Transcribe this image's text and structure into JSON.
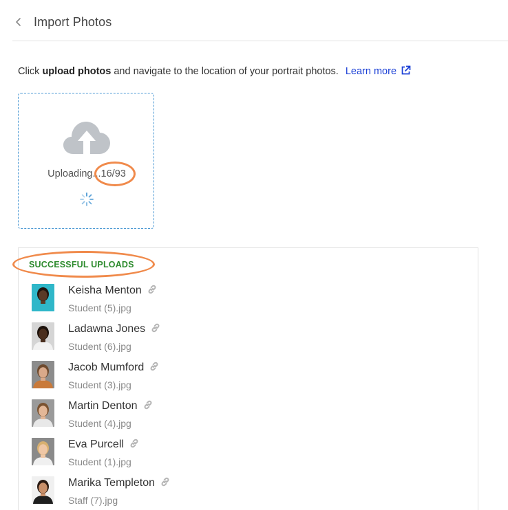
{
  "header": {
    "title": "Import Photos",
    "back_icon": "chevron-left-icon"
  },
  "instruction": {
    "prefix": "Click ",
    "bold": "upload photos",
    "suffix": " and navigate to the location of your portrait photos.",
    "learn_more": "Learn more",
    "learn_more_color": "#1a3fd6"
  },
  "upload": {
    "status_text": "Uploading...",
    "progress": "16/93",
    "icon": "cloud-upload-icon",
    "spinner": "spinner-icon",
    "border_color": "#4a98d4"
  },
  "uploads": {
    "heading": "SUCCESSFUL UPLOADS",
    "heading_color": "#2e8b2e",
    "items": [
      {
        "name": "Keisha Menton",
        "file": "Student (5).jpg",
        "thumb": {
          "bg": "#2fb7c9",
          "skin": "#5a3a26",
          "hair": "#1e140e",
          "shirt": "#2fb7c9"
        }
      },
      {
        "name": "Ladawna Jones",
        "file": "Student (6).jpg",
        "thumb": {
          "bg": "#d5d5d5",
          "skin": "#4a2e1e",
          "hair": "#1a100a",
          "shirt": "#f2f2f2"
        }
      },
      {
        "name": "Jacob Mumford",
        "file": "Student (3).jpg",
        "thumb": {
          "bg": "#8c8c8c",
          "skin": "#d9a98a",
          "hair": "#6e4a2e",
          "shirt": "#c97a3a"
        }
      },
      {
        "name": "Martin Denton",
        "file": "Student (4).jpg",
        "thumb": {
          "bg": "#9a9a9a",
          "skin": "#e3b797",
          "hair": "#7a5230",
          "shirt": "#e8e8e8"
        }
      },
      {
        "name": "Eva Purcell",
        "file": "Student (1).jpg",
        "thumb": {
          "bg": "#8a8a8a",
          "skin": "#efc7a6",
          "hair": "#d8b070",
          "shirt": "#f0f0f0"
        }
      },
      {
        "name": "Marika Templeton",
        "file": "Staff (7).jpg",
        "thumb": {
          "bg": "#f0f0f0",
          "skin": "#c9906a",
          "hair": "#2a1a12",
          "shirt": "#1e1e1e"
        }
      }
    ]
  },
  "annotation_color": "#f08a4b"
}
